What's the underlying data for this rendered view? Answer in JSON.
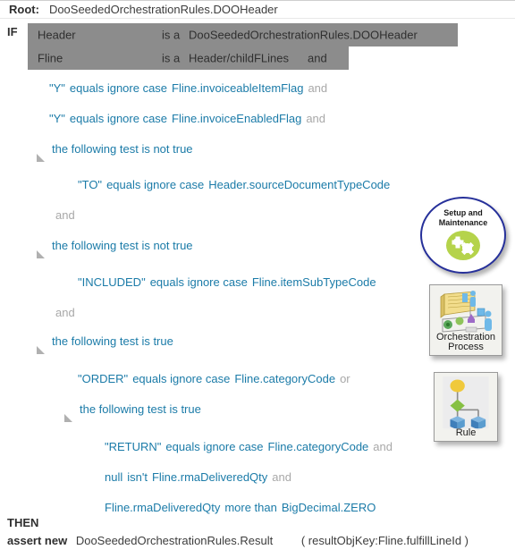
{
  "root": {
    "label": "Root:",
    "value": "DooSeededOrchestrationRules.DOOHeader"
  },
  "if": {
    "label": "IF",
    "patterns": [
      {
        "name": "Header",
        "operator": "is a",
        "type": "DooSeededOrchestrationRules.DOOHeader",
        "conjunction": ""
      },
      {
        "name": "Fline",
        "operator": "is a",
        "type": "Header/childFLines",
        "conjunction": "and"
      }
    ],
    "conditions": [
      {
        "id": "c1",
        "tokens": [
          {
            "text": "\"Y\"",
            "style": "blue"
          },
          {
            "text": "equals ignore case",
            "style": "blue"
          },
          {
            "text": "Fline.invoiceableItemFlag",
            "style": "blue"
          },
          {
            "text": "and",
            "style": "grey"
          }
        ]
      },
      {
        "id": "c2",
        "tokens": [
          {
            "text": "\"Y\"",
            "style": "blue"
          },
          {
            "text": "equals ignore case",
            "style": "blue"
          },
          {
            "text": "Fline.invoiceEnabledFlag",
            "style": "blue"
          },
          {
            "text": "and",
            "style": "grey"
          }
        ]
      },
      {
        "id": "c3",
        "tokens": [
          {
            "text": "the following test is not true",
            "style": "blue"
          }
        ]
      },
      {
        "id": "c4",
        "tokens": [
          {
            "text": "\"TO\"",
            "style": "blue"
          },
          {
            "text": "equals ignore case",
            "style": "blue"
          },
          {
            "text": "Header.sourceDocumentTypeCode",
            "style": "blue"
          }
        ]
      },
      {
        "id": "c5",
        "tokens": [
          {
            "text": "and",
            "style": "grey"
          }
        ]
      },
      {
        "id": "c6",
        "tokens": [
          {
            "text": "the following test is not true",
            "style": "blue"
          }
        ]
      },
      {
        "id": "c7",
        "tokens": [
          {
            "text": "\"INCLUDED\"",
            "style": "blue"
          },
          {
            "text": "equals ignore case",
            "style": "blue"
          },
          {
            "text": "Fline.itemSubTypeCode",
            "style": "blue"
          }
        ]
      },
      {
        "id": "c8",
        "tokens": [
          {
            "text": "and",
            "style": "grey"
          }
        ]
      },
      {
        "id": "c9",
        "tokens": [
          {
            "text": "the following test is true",
            "style": "blue"
          }
        ]
      },
      {
        "id": "c10",
        "tokens": [
          {
            "text": "\"ORDER\"",
            "style": "blue"
          },
          {
            "text": "equals ignore case",
            "style": "blue"
          },
          {
            "text": "Fline.categoryCode",
            "style": "blue"
          },
          {
            "text": "or",
            "style": "grey"
          }
        ]
      },
      {
        "id": "c11",
        "tokens": [
          {
            "text": "the following test is true",
            "style": "blue"
          }
        ]
      },
      {
        "id": "c12",
        "tokens": [
          {
            "text": "\"RETURN\"",
            "style": "blue"
          },
          {
            "text": "equals ignore case",
            "style": "blue"
          },
          {
            "text": "Fline.categoryCode",
            "style": "blue"
          },
          {
            "text": "and",
            "style": "grey"
          }
        ]
      },
      {
        "id": "c13",
        "tokens": [
          {
            "text": "null",
            "style": "blue"
          },
          {
            "text": "isn't",
            "style": "blue"
          },
          {
            "text": "Fline.rmaDeliveredQty",
            "style": "blue"
          },
          {
            "text": "and",
            "style": "grey"
          }
        ]
      },
      {
        "id": "c14",
        "tokens": [
          {
            "text": "Fline.rmaDeliveredQty",
            "style": "blue"
          },
          {
            "text": "more than",
            "style": "blue"
          },
          {
            "text": "BigDecimal.ZERO",
            "style": "blue"
          }
        ]
      }
    ]
  },
  "then": {
    "label": "THEN",
    "action": "assert new",
    "target": "DooSeededOrchestrationRules.Result",
    "arguments": "( resultObjKey:Fline.fulfillLineId )"
  },
  "icons": [
    {
      "name": "setup-and-maintenance",
      "caption_line1": "Setup and",
      "caption_line2": "Maintenance"
    },
    {
      "name": "orchestration-process",
      "caption_line1": "Orchestration",
      "caption_line2": "Process"
    },
    {
      "name": "rule",
      "caption_line1": "Rule",
      "caption_line2": ""
    }
  ],
  "colors": {
    "expression": "#1b7ba8",
    "conjunction": "#a8a8a8",
    "selection": "#8c8c8c",
    "setup_ring": "#26309a",
    "setup_disc": "#b5d34b"
  }
}
